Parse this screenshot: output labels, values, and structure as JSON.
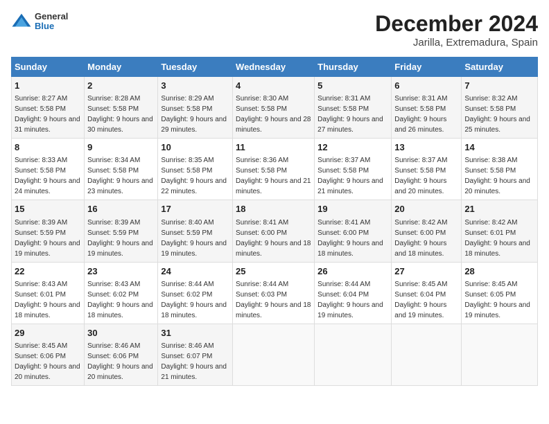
{
  "logo": {
    "general": "General",
    "blue": "Blue"
  },
  "title": "December 2024",
  "subtitle": "Jarilla, Extremadura, Spain",
  "weekdays": [
    "Sunday",
    "Monday",
    "Tuesday",
    "Wednesday",
    "Thursday",
    "Friday",
    "Saturday"
  ],
  "weeks": [
    [
      {
        "day": 1,
        "rise": "8:27 AM",
        "set": "5:58 PM",
        "daylight": "9 hours and 31 minutes."
      },
      {
        "day": 2,
        "rise": "8:28 AM",
        "set": "5:58 PM",
        "daylight": "9 hours and 30 minutes."
      },
      {
        "day": 3,
        "rise": "8:29 AM",
        "set": "5:58 PM",
        "daylight": "9 hours and 29 minutes."
      },
      {
        "day": 4,
        "rise": "8:30 AM",
        "set": "5:58 PM",
        "daylight": "9 hours and 28 minutes."
      },
      {
        "day": 5,
        "rise": "8:31 AM",
        "set": "5:58 PM",
        "daylight": "9 hours and 27 minutes."
      },
      {
        "day": 6,
        "rise": "8:31 AM",
        "set": "5:58 PM",
        "daylight": "9 hours and 26 minutes."
      },
      {
        "day": 7,
        "rise": "8:32 AM",
        "set": "5:58 PM",
        "daylight": "9 hours and 25 minutes."
      }
    ],
    [
      {
        "day": 8,
        "rise": "8:33 AM",
        "set": "5:58 PM",
        "daylight": "9 hours and 24 minutes."
      },
      {
        "day": 9,
        "rise": "8:34 AM",
        "set": "5:58 PM",
        "daylight": "9 hours and 23 minutes."
      },
      {
        "day": 10,
        "rise": "8:35 AM",
        "set": "5:58 PM",
        "daylight": "9 hours and 22 minutes."
      },
      {
        "day": 11,
        "rise": "8:36 AM",
        "set": "5:58 PM",
        "daylight": "9 hours and 21 minutes."
      },
      {
        "day": 12,
        "rise": "8:37 AM",
        "set": "5:58 PM",
        "daylight": "9 hours and 21 minutes."
      },
      {
        "day": 13,
        "rise": "8:37 AM",
        "set": "5:58 PM",
        "daylight": "9 hours and 20 minutes."
      },
      {
        "day": 14,
        "rise": "8:38 AM",
        "set": "5:58 PM",
        "daylight": "9 hours and 20 minutes."
      }
    ],
    [
      {
        "day": 15,
        "rise": "8:39 AM",
        "set": "5:59 PM",
        "daylight": "9 hours and 19 minutes."
      },
      {
        "day": 16,
        "rise": "8:39 AM",
        "set": "5:59 PM",
        "daylight": "9 hours and 19 minutes."
      },
      {
        "day": 17,
        "rise": "8:40 AM",
        "set": "5:59 PM",
        "daylight": "9 hours and 19 minutes."
      },
      {
        "day": 18,
        "rise": "8:41 AM",
        "set": "6:00 PM",
        "daylight": "9 hours and 18 minutes."
      },
      {
        "day": 19,
        "rise": "8:41 AM",
        "set": "6:00 PM",
        "daylight": "9 hours and 18 minutes."
      },
      {
        "day": 20,
        "rise": "8:42 AM",
        "set": "6:00 PM",
        "daylight": "9 hours and 18 minutes."
      },
      {
        "day": 21,
        "rise": "8:42 AM",
        "set": "6:01 PM",
        "daylight": "9 hours and 18 minutes."
      }
    ],
    [
      {
        "day": 22,
        "rise": "8:43 AM",
        "set": "6:01 PM",
        "daylight": "9 hours and 18 minutes."
      },
      {
        "day": 23,
        "rise": "8:43 AM",
        "set": "6:02 PM",
        "daylight": "9 hours and 18 minutes."
      },
      {
        "day": 24,
        "rise": "8:44 AM",
        "set": "6:02 PM",
        "daylight": "9 hours and 18 minutes."
      },
      {
        "day": 25,
        "rise": "8:44 AM",
        "set": "6:03 PM",
        "daylight": "9 hours and 18 minutes."
      },
      {
        "day": 26,
        "rise": "8:44 AM",
        "set": "6:04 PM",
        "daylight": "9 hours and 19 minutes."
      },
      {
        "day": 27,
        "rise": "8:45 AM",
        "set": "6:04 PM",
        "daylight": "9 hours and 19 minutes."
      },
      {
        "day": 28,
        "rise": "8:45 AM",
        "set": "6:05 PM",
        "daylight": "9 hours and 19 minutes."
      }
    ],
    [
      {
        "day": 29,
        "rise": "8:45 AM",
        "set": "6:06 PM",
        "daylight": "9 hours and 20 minutes."
      },
      {
        "day": 30,
        "rise": "8:46 AM",
        "set": "6:06 PM",
        "daylight": "9 hours and 20 minutes."
      },
      {
        "day": 31,
        "rise": "8:46 AM",
        "set": "6:07 PM",
        "daylight": "9 hours and 21 minutes."
      },
      null,
      null,
      null,
      null
    ]
  ]
}
